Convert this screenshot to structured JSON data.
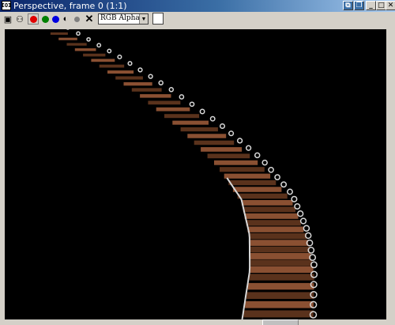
{
  "window": {
    "title": "Perspective, frame 0 (1:1)",
    "title_icon": "IOI"
  },
  "toolbar": {
    "icons": [
      {
        "name": "save-icon",
        "glyph": "▣"
      },
      {
        "name": "clone-icon",
        "glyph": "⚇"
      },
      {
        "name": "red-channel-icon",
        "color": "#e00000"
      },
      {
        "name": "green-channel-icon",
        "color": "#008000"
      },
      {
        "name": "blue-channel-icon",
        "color": "#0000e0"
      },
      {
        "name": "mono-icon",
        "glyph": "◐"
      },
      {
        "name": "alpha-icon",
        "color": "#808080"
      },
      {
        "name": "clear-icon",
        "glyph": "✕"
      }
    ],
    "channel_select": "RGB Alpha",
    "swatch_color": "#ffffff"
  },
  "colors": {
    "wood": "#8a5032",
    "wood_dark": "#5a321c",
    "rail": "#d8d8d8"
  }
}
